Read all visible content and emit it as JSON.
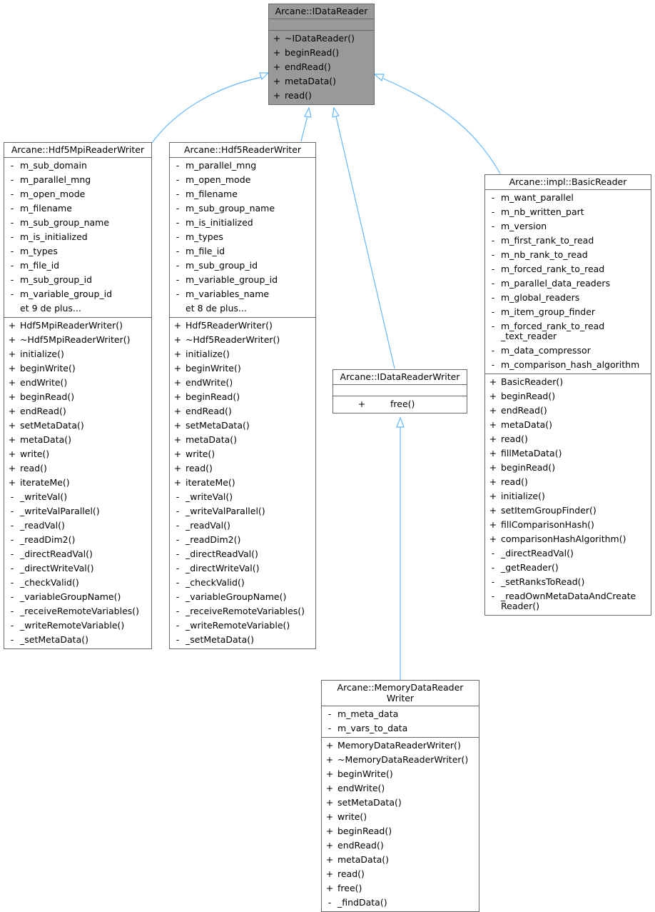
{
  "diagram": {
    "edge_color": "#63b8ff",
    "classes": {
      "idatareader": {
        "name": "Arcane::IDataReader",
        "attributes": [],
        "methods": [
          {
            "vis": "+",
            "name": "~IDataReader()"
          },
          {
            "vis": "+",
            "name": "beginRead()"
          },
          {
            "vis": "+",
            "name": "endRead()"
          },
          {
            "vis": "+",
            "name": "metaData()"
          },
          {
            "vis": "+",
            "name": "read()"
          }
        ]
      },
      "hdf5mpi": {
        "name": "Arcane::Hdf5MpiReaderWriter",
        "attributes": [
          {
            "vis": "-",
            "name": "m_sub_domain"
          },
          {
            "vis": "-",
            "name": "m_parallel_mng"
          },
          {
            "vis": "-",
            "name": "m_open_mode"
          },
          {
            "vis": "-",
            "name": "m_filename"
          },
          {
            "vis": "-",
            "name": "m_sub_group_name"
          },
          {
            "vis": "-",
            "name": "m_is_initialized"
          },
          {
            "vis": "-",
            "name": "m_types"
          },
          {
            "vis": "-",
            "name": "m_file_id"
          },
          {
            "vis": "-",
            "name": "m_sub_group_id"
          },
          {
            "vis": "-",
            "name": "m_variable_group_id"
          },
          {
            "vis": "",
            "name": "et 9 de plus..."
          }
        ],
        "methods": [
          {
            "vis": "+",
            "name": "Hdf5MpiReaderWriter()"
          },
          {
            "vis": "+",
            "name": "~Hdf5MpiReaderWriter()"
          },
          {
            "vis": "+",
            "name": "initialize()"
          },
          {
            "vis": "+",
            "name": "beginWrite()"
          },
          {
            "vis": "+",
            "name": "endWrite()"
          },
          {
            "vis": "+",
            "name": "beginRead()"
          },
          {
            "vis": "+",
            "name": "endRead()"
          },
          {
            "vis": "+",
            "name": "setMetaData()"
          },
          {
            "vis": "+",
            "name": "metaData()"
          },
          {
            "vis": "+",
            "name": "write()"
          },
          {
            "vis": "+",
            "name": "read()"
          },
          {
            "vis": "+",
            "name": "iterateMe()"
          },
          {
            "vis": "-",
            "name": "_writeVal()"
          },
          {
            "vis": "-",
            "name": "_writeValParallel()"
          },
          {
            "vis": "-",
            "name": "_readVal()"
          },
          {
            "vis": "-",
            "name": "_readDim2()"
          },
          {
            "vis": "-",
            "name": "_directReadVal()"
          },
          {
            "vis": "-",
            "name": "_directWriteVal()"
          },
          {
            "vis": "-",
            "name": "_checkValid()"
          },
          {
            "vis": "-",
            "name": "_variableGroupName()"
          },
          {
            "vis": "-",
            "name": "_receiveRemoteVariables()"
          },
          {
            "vis": "-",
            "name": "_writeRemoteVariable()"
          },
          {
            "vis": "-",
            "name": "_setMetaData()"
          }
        ]
      },
      "hdf5": {
        "name": "Arcane::Hdf5ReaderWriter",
        "attributes": [
          {
            "vis": "-",
            "name": "m_parallel_mng"
          },
          {
            "vis": "-",
            "name": "m_open_mode"
          },
          {
            "vis": "-",
            "name": "m_filename"
          },
          {
            "vis": "-",
            "name": "m_sub_group_name"
          },
          {
            "vis": "-",
            "name": "m_is_initialized"
          },
          {
            "vis": "-",
            "name": "m_types"
          },
          {
            "vis": "-",
            "name": "m_file_id"
          },
          {
            "vis": "-",
            "name": "m_sub_group_id"
          },
          {
            "vis": "-",
            "name": "m_variable_group_id"
          },
          {
            "vis": "-",
            "name": "m_variables_name"
          },
          {
            "vis": "",
            "name": "et 8 de plus..."
          }
        ],
        "methods": [
          {
            "vis": "+",
            "name": "Hdf5ReaderWriter()"
          },
          {
            "vis": "+",
            "name": "~Hdf5ReaderWriter()"
          },
          {
            "vis": "+",
            "name": "initialize()"
          },
          {
            "vis": "+",
            "name": "beginWrite()"
          },
          {
            "vis": "+",
            "name": "endWrite()"
          },
          {
            "vis": "+",
            "name": "beginRead()"
          },
          {
            "vis": "+",
            "name": "endRead()"
          },
          {
            "vis": "+",
            "name": "setMetaData()"
          },
          {
            "vis": "+",
            "name": "metaData()"
          },
          {
            "vis": "+",
            "name": "write()"
          },
          {
            "vis": "+",
            "name": "read()"
          },
          {
            "vis": "+",
            "name": "iterateMe()"
          },
          {
            "vis": "-",
            "name": "_writeVal()"
          },
          {
            "vis": "-",
            "name": "_writeValParallel()"
          },
          {
            "vis": "-",
            "name": "_readVal()"
          },
          {
            "vis": "-",
            "name": "_readDim2()"
          },
          {
            "vis": "-",
            "name": "_directReadVal()"
          },
          {
            "vis": "-",
            "name": "_directWriteVal()"
          },
          {
            "vis": "-",
            "name": "_checkValid()"
          },
          {
            "vis": "-",
            "name": "_variableGroupName()"
          },
          {
            "vis": "-",
            "name": "_receiveRemoteVariables()"
          },
          {
            "vis": "-",
            "name": "_writeRemoteVariable()"
          },
          {
            "vis": "-",
            "name": "_setMetaData()"
          }
        ]
      },
      "idatareaderwriter": {
        "name": "Arcane::IDataReaderWriter",
        "attributes": [],
        "methods": [
          {
            "vis": "+",
            "name": "free()"
          }
        ]
      },
      "basicreader": {
        "name": "Arcane::impl::BasicReader",
        "attributes": [
          {
            "vis": "-",
            "name": "m_want_parallel"
          },
          {
            "vis": "-",
            "name": "m_nb_written_part"
          },
          {
            "vis": "-",
            "name": "m_version"
          },
          {
            "vis": "-",
            "name": "m_first_rank_to_read"
          },
          {
            "vis": "-",
            "name": "m_nb_rank_to_read"
          },
          {
            "vis": "-",
            "name": "m_forced_rank_to_read"
          },
          {
            "vis": "-",
            "name": "m_parallel_data_readers"
          },
          {
            "vis": "-",
            "name": "m_global_readers"
          },
          {
            "vis": "-",
            "name": "m_item_group_finder"
          },
          {
            "vis": "-",
            "name": "m_forced_rank_to_read _text_reader"
          },
          {
            "vis": "-",
            "name": "m_data_compressor"
          },
          {
            "vis": "-",
            "name": "m_comparison_hash_algorithm"
          }
        ],
        "methods": [
          {
            "vis": "+",
            "name": "BasicReader()"
          },
          {
            "vis": "+",
            "name": "beginRead()"
          },
          {
            "vis": "+",
            "name": "endRead()"
          },
          {
            "vis": "+",
            "name": "metaData()"
          },
          {
            "vis": "+",
            "name": "read()"
          },
          {
            "vis": "+",
            "name": "fillMetaData()"
          },
          {
            "vis": "+",
            "name": "beginRead()"
          },
          {
            "vis": "+",
            "name": "read()"
          },
          {
            "vis": "+",
            "name": "initialize()"
          },
          {
            "vis": "+",
            "name": "setItemGroupFinder()"
          },
          {
            "vis": "+",
            "name": "fillComparisonHash()"
          },
          {
            "vis": "+",
            "name": "comparisonHashAlgorithm()"
          },
          {
            "vis": "-",
            "name": "_directReadVal()"
          },
          {
            "vis": "-",
            "name": "_getReader()"
          },
          {
            "vis": "-",
            "name": "_setRanksToRead()"
          },
          {
            "vis": "-",
            "name": "_readOwnMetaDataAndCreate Reader()"
          }
        ]
      },
      "memory": {
        "name": "Arcane::MemoryDataReader\nWriter",
        "attributes": [
          {
            "vis": "-",
            "name": "m_meta_data"
          },
          {
            "vis": "-",
            "name": "m_vars_to_data"
          }
        ],
        "methods": [
          {
            "vis": "+",
            "name": "MemoryDataReaderWriter()"
          },
          {
            "vis": "+",
            "name": "~MemoryDataReaderWriter()"
          },
          {
            "vis": "+",
            "name": "beginWrite()"
          },
          {
            "vis": "+",
            "name": "endWrite()"
          },
          {
            "vis": "+",
            "name": "setMetaData()"
          },
          {
            "vis": "+",
            "name": "write()"
          },
          {
            "vis": "+",
            "name": "beginRead()"
          },
          {
            "vis": "+",
            "name": "endRead()"
          },
          {
            "vis": "+",
            "name": "metaData()"
          },
          {
            "vis": "+",
            "name": "read()"
          },
          {
            "vis": "+",
            "name": "free()"
          },
          {
            "vis": "-",
            "name": "_findData()"
          }
        ]
      }
    }
  }
}
